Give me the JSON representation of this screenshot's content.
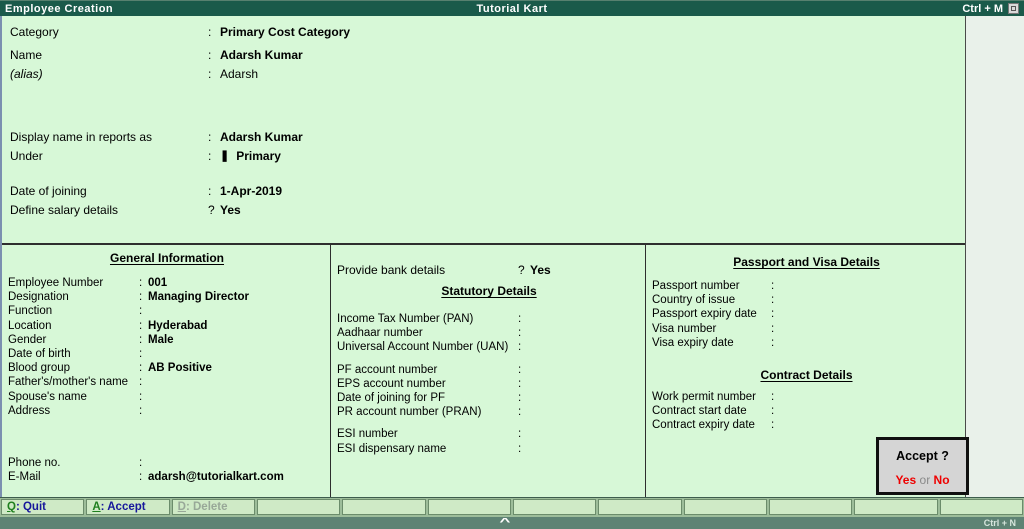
{
  "sep": {
    "colon": ":",
    "question": "?"
  },
  "colors": {
    "titlebar_bg": "#1A5A4A",
    "form_bg": "#D7F8D7",
    "accent_red": "#EE0000",
    "shortcut_key_green": "#1E7F1E",
    "button_text_navy": "#16169B"
  },
  "titlebar": {
    "title": "Employee Creation",
    "company": "Tutorial Kart",
    "shortcut": "Ctrl + M"
  },
  "top_form": {
    "category": {
      "label": "Category",
      "value": "Primary Cost Category"
    },
    "name": {
      "label": "Name",
      "value": "Adarsh Kumar"
    },
    "alias": {
      "label": "(alias)",
      "value": "Adarsh"
    },
    "display_name": {
      "label": "Display name in reports as",
      "value": "Adarsh Kumar"
    },
    "under": {
      "label": "Under",
      "icon": "❚",
      "value": "Primary"
    },
    "date_of_joining": {
      "label": "Date of joining",
      "value": "1-Apr-2019"
    },
    "define_salary": {
      "label": "Define salary details",
      "value": "Yes"
    }
  },
  "general_information": {
    "heading": "General Information",
    "fields": [
      {
        "label": "Employee Number",
        "value": "001"
      },
      {
        "label": "Designation",
        "value": "Managing Director"
      },
      {
        "label": "Function",
        "value": ""
      },
      {
        "label": "Location",
        "value": "Hyderabad"
      },
      {
        "label": "Gender",
        "value": "Male"
      },
      {
        "label": "Date of birth",
        "value": ""
      },
      {
        "label": "Blood group",
        "value": "AB Positive"
      },
      {
        "label": "Father's/mother's name",
        "value": ""
      },
      {
        "label": "Spouse's name",
        "value": ""
      },
      {
        "label": "Address",
        "value": ""
      }
    ],
    "contact_fields": [
      {
        "label": "Phone no.",
        "value": ""
      },
      {
        "label": "E-Mail",
        "value": "adarsh@tutorialkart.com"
      }
    ]
  },
  "statutory": {
    "bank": {
      "label": "Provide bank details",
      "value": "Yes"
    },
    "heading": "Statutory Details",
    "tax_fields": [
      {
        "label": "Income Tax Number (PAN)",
        "value": ""
      },
      {
        "label": "Aadhaar number",
        "value": ""
      },
      {
        "label": "Universal Account Number (UAN)",
        "value": ""
      }
    ],
    "pf_fields": [
      {
        "label": "PF account number",
        "value": ""
      },
      {
        "label": "EPS account number",
        "value": ""
      },
      {
        "label": "Date of joining for PF",
        "value": ""
      },
      {
        "label": "PR account number (PRAN)",
        "value": ""
      }
    ],
    "esi_fields": [
      {
        "label": "ESI number",
        "value": ""
      },
      {
        "label": "ESI dispensary name",
        "value": ""
      }
    ]
  },
  "passport": {
    "heading": "Passport and Visa Details",
    "fields": [
      {
        "label": "Passport number",
        "value": ""
      },
      {
        "label": "Country of issue",
        "value": ""
      },
      {
        "label": "Passport expiry date",
        "value": ""
      },
      {
        "label": "Visa number",
        "value": ""
      },
      {
        "label": "Visa expiry date",
        "value": ""
      }
    ]
  },
  "contract": {
    "heading": "Contract Details",
    "fields": [
      {
        "label": "Work permit number",
        "value": ""
      },
      {
        "label": "Contract start date",
        "value": ""
      },
      {
        "label": "Contract expiry date",
        "value": ""
      }
    ]
  },
  "accept_dialog": {
    "title": "Accept ?",
    "yes": "Yes",
    "or": "or",
    "no": "No"
  },
  "toolbar": {
    "buttons": [
      {
        "key": "Q",
        "label": ": Quit"
      },
      {
        "key": "A",
        "label": ": Accept"
      },
      {
        "key": "D",
        "label": ": Delete"
      }
    ]
  },
  "statusbar": {
    "caret": "^",
    "shortcut": "Ctrl + N"
  }
}
